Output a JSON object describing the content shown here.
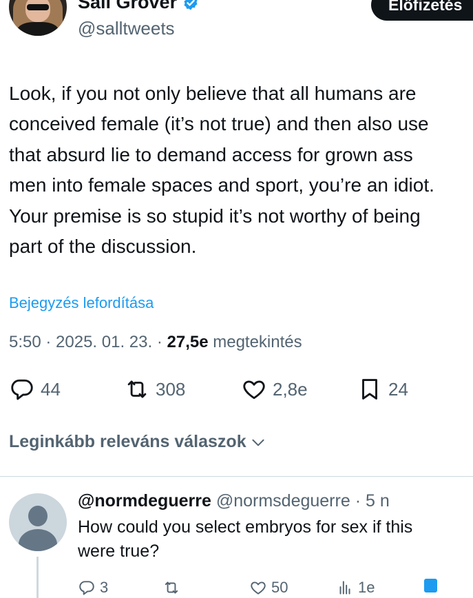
{
  "author": {
    "name": "Sall Grover",
    "handle": "@salltweets",
    "subscribe_label": "Előfizetés"
  },
  "tweet": {
    "lines": [
      "Look, if you not only believe that all humans are",
      "conceived female (it’s not true) and then also use",
      "that absurd lie to demand access for grown ass",
      "men into female spaces and sport, you’re an idiot.",
      "Your premise is so stupid it’s not worthy of being",
      "part of the discussion."
    ],
    "translate_label": "Bejegyzés lefordítása",
    "time": "5:50 · 2025. 01. 23. · ",
    "views_count": "27,5e",
    "views_label": " megtekintés"
  },
  "stats": {
    "replies": "44",
    "reposts": "308",
    "likes": "2,8e",
    "bookmarks": "24"
  },
  "replies_section": {
    "sort_label": "Leginkább releváns válaszok"
  },
  "reply": {
    "name": "@normdeguerre",
    "handle": "@normsdeguerre",
    "time": "5 n",
    "lines": [
      "How could you select embryos for sex if this",
      "were true?"
    ],
    "stats": {
      "replies": "3",
      "likes": "50",
      "views": "1e"
    }
  },
  "colors": {
    "accent": "#1d9bf0",
    "secondary_text": "#536471",
    "primary_text": "#0f1419"
  }
}
